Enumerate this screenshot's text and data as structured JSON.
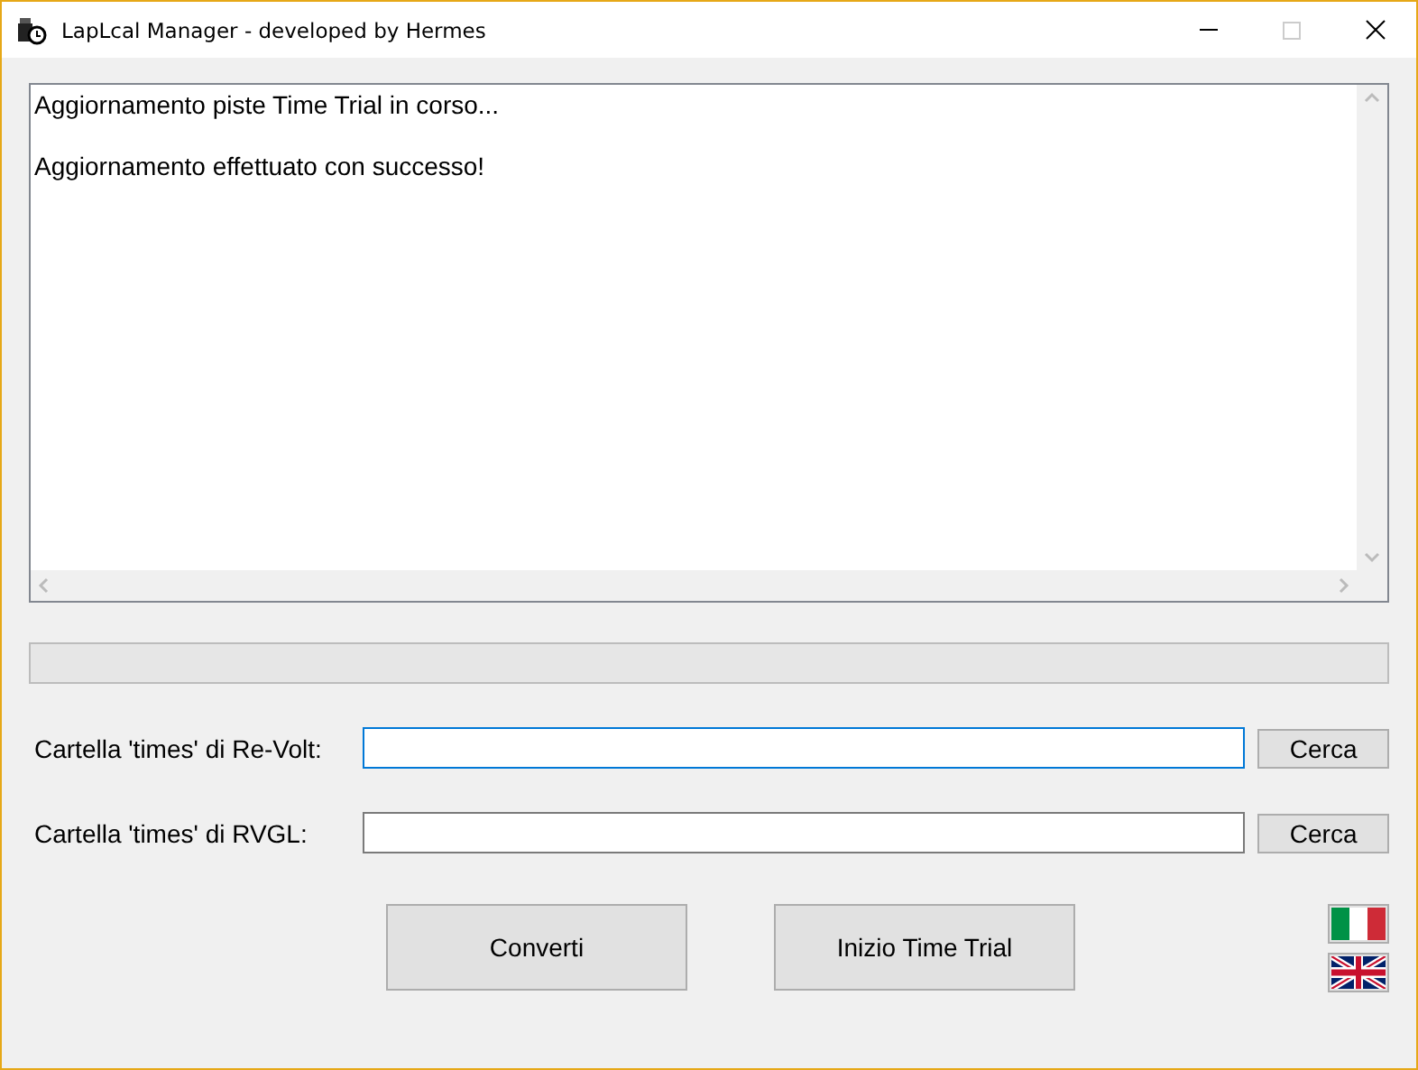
{
  "window": {
    "title": "LapLcal Manager - developed by Hermes"
  },
  "log": {
    "lines": [
      "Aggiornamento piste Time Trial in corso...",
      "Aggiornamento effettuato con successo!"
    ]
  },
  "progress": {
    "level": 0
  },
  "folders": [
    {
      "label": "Cartella 'times' di Re-Volt:",
      "focused": true,
      "button": "Cerca"
    },
    {
      "label": "Cartella 'times' di RVGL:",
      "focused": false,
      "button": "Cerca"
    }
  ],
  "actions": [
    "Converti",
    "Inizio Time Trial"
  ],
  "languages": [
    {
      "kind": "italian"
    },
    {
      "kind": "english"
    }
  ]
}
